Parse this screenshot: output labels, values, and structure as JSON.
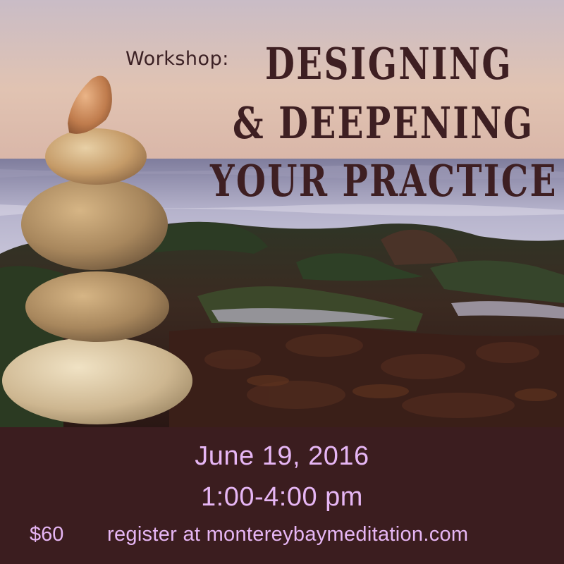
{
  "headline": {
    "kicker": "Workshop:",
    "line1": "DESIGNING",
    "line2": "& DEEPENING",
    "line3": "YOUR PRACTICE"
  },
  "event": {
    "date": "June 19, 2016",
    "time": "1:00-4:00 pm",
    "price": "$60",
    "register": "register at montereybaymeditation.com"
  },
  "colors": {
    "banner_bg": "#3b1d1f",
    "banner_text": "#e6b6f4",
    "title_text": "#3e1f22"
  }
}
